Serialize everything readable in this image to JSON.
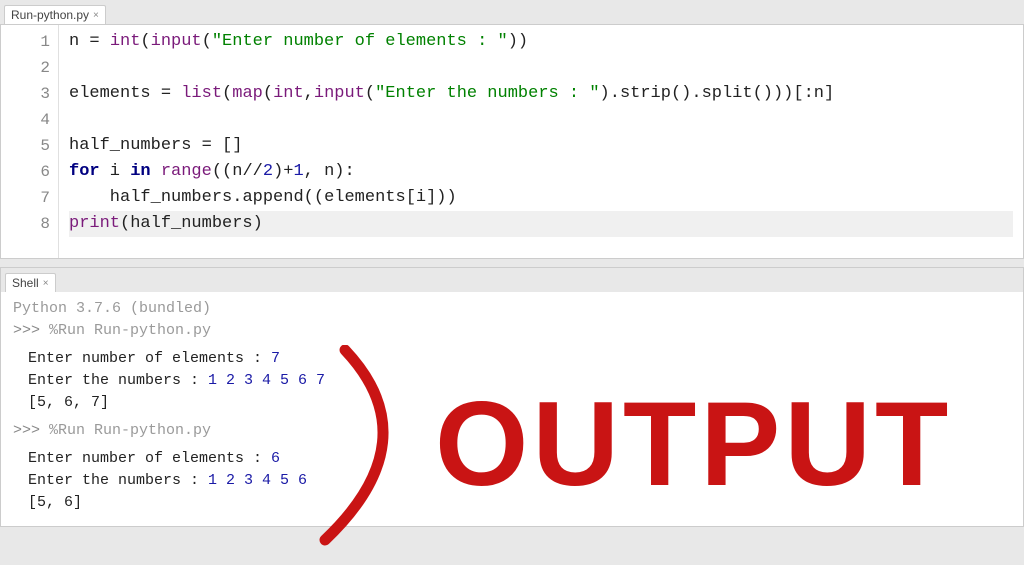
{
  "editor": {
    "tab_label": "Run-python.py",
    "lines": [
      {
        "n": 1,
        "tokens": [
          {
            "t": "n ",
            "c": "pl"
          },
          {
            "t": "=",
            "c": "op"
          },
          {
            "t": " ",
            "c": "pl"
          },
          {
            "t": "int",
            "c": "fn"
          },
          {
            "t": "(",
            "c": "op"
          },
          {
            "t": "input",
            "c": "fn"
          },
          {
            "t": "(",
            "c": "op"
          },
          {
            "t": "\"Enter number of elements : \"",
            "c": "str"
          },
          {
            "t": "))",
            "c": "op"
          }
        ]
      },
      {
        "n": 2,
        "tokens": []
      },
      {
        "n": 3,
        "tokens": [
          {
            "t": "elements ",
            "c": "pl"
          },
          {
            "t": "=",
            "c": "op"
          },
          {
            "t": " ",
            "c": "pl"
          },
          {
            "t": "list",
            "c": "fn"
          },
          {
            "t": "(",
            "c": "op"
          },
          {
            "t": "map",
            "c": "fn"
          },
          {
            "t": "(",
            "c": "op"
          },
          {
            "t": "int",
            "c": "fn"
          },
          {
            "t": ",",
            "c": "op"
          },
          {
            "t": "input",
            "c": "fn"
          },
          {
            "t": "(",
            "c": "op"
          },
          {
            "t": "\"Enter the numbers : \"",
            "c": "str"
          },
          {
            "t": ").",
            "c": "op"
          },
          {
            "t": "strip",
            "c": "pl"
          },
          {
            "t": "().",
            "c": "op"
          },
          {
            "t": "split",
            "c": "pl"
          },
          {
            "t": "()))[:",
            "c": "op"
          },
          {
            "t": "n",
            "c": "pl"
          },
          {
            "t": "]",
            "c": "op"
          }
        ]
      },
      {
        "n": 4,
        "tokens": []
      },
      {
        "n": 5,
        "tokens": [
          {
            "t": "half_numbers ",
            "c": "pl"
          },
          {
            "t": "=",
            "c": "op"
          },
          {
            "t": " []",
            "c": "op"
          }
        ]
      },
      {
        "n": 6,
        "tokens": [
          {
            "t": "for",
            "c": "kw"
          },
          {
            "t": " i ",
            "c": "pl"
          },
          {
            "t": "in",
            "c": "kw"
          },
          {
            "t": " ",
            "c": "pl"
          },
          {
            "t": "range",
            "c": "fn"
          },
          {
            "t": "((",
            "c": "op"
          },
          {
            "t": "n",
            "c": "pl"
          },
          {
            "t": "//",
            "c": "op"
          },
          {
            "t": "2",
            "c": "num"
          },
          {
            "t": ")+",
            "c": "op"
          },
          {
            "t": "1",
            "c": "num"
          },
          {
            "t": ", ",
            "c": "op"
          },
          {
            "t": "n",
            "c": "pl"
          },
          {
            "t": "):",
            "c": "op"
          }
        ]
      },
      {
        "n": 7,
        "tokens": [
          {
            "t": "    half_numbers.",
            "c": "pl"
          },
          {
            "t": "append",
            "c": "pl"
          },
          {
            "t": "((",
            "c": "op"
          },
          {
            "t": "elements",
            "c": "pl"
          },
          {
            "t": "[",
            "c": "op"
          },
          {
            "t": "i",
            "c": "pl"
          },
          {
            "t": "]))",
            "c": "op"
          }
        ]
      },
      {
        "n": 8,
        "current": true,
        "tokens": [
          {
            "t": "print",
            "c": "fn"
          },
          {
            "t": "(",
            "c": "op"
          },
          {
            "t": "half_numbers",
            "c": "pl"
          },
          {
            "t": ")",
            "c": "op"
          }
        ]
      }
    ]
  },
  "shell": {
    "tab_label": "Shell",
    "version_line": "Python 3.7.6 (bundled)",
    "prompt": ">>>",
    "runs": [
      {
        "command": "%Run Run-python.py",
        "io": [
          {
            "prompt": "Enter number of elements : ",
            "input": "7"
          },
          {
            "prompt": "Enter the numbers : ",
            "input": "1 2 3 4 5 6 7"
          }
        ],
        "output": "[5, 6, 7]"
      },
      {
        "command": "%Run Run-python.py",
        "io": [
          {
            "prompt": "Enter number of elements : ",
            "input": "6"
          },
          {
            "prompt": "Enter the numbers : ",
            "input": "1 2 3 4 5 6"
          }
        ],
        "output": "[5, 6]"
      }
    ]
  },
  "annotation": {
    "text": "OUTPUT",
    "color": "#c91414"
  }
}
